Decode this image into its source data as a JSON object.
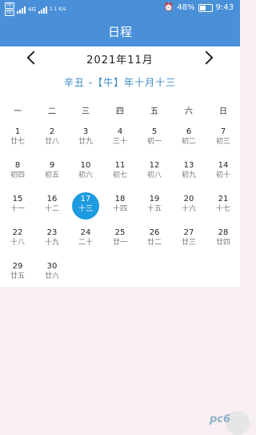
{
  "status_bar": {
    "sim1": "HD",
    "sim2": "HD",
    "network": "4G",
    "speed": "1.1 K/s",
    "battery": "48%",
    "time": "9:43"
  },
  "header": {
    "title": "日程"
  },
  "calendar": {
    "month_label": "2021年11月",
    "lunar_label": "辛丑 -【牛】年十月十三",
    "weekdays": [
      "一",
      "二",
      "三",
      "四",
      "五",
      "六",
      "日"
    ],
    "days": [
      {
        "day": "1",
        "lunar": "廿七"
      },
      {
        "day": "2",
        "lunar": "廿八"
      },
      {
        "day": "3",
        "lunar": "廿九"
      },
      {
        "day": "4",
        "lunar": "三十"
      },
      {
        "day": "5",
        "lunar": "初一"
      },
      {
        "day": "6",
        "lunar": "初二"
      },
      {
        "day": "7",
        "lunar": "初三"
      },
      {
        "day": "8",
        "lunar": "初四"
      },
      {
        "day": "9",
        "lunar": "初五"
      },
      {
        "day": "10",
        "lunar": "初六"
      },
      {
        "day": "11",
        "lunar": "初七"
      },
      {
        "day": "12",
        "lunar": "初八"
      },
      {
        "day": "13",
        "lunar": "初九"
      },
      {
        "day": "14",
        "lunar": "初十"
      },
      {
        "day": "15",
        "lunar": "十一"
      },
      {
        "day": "16",
        "lunar": "十二"
      },
      {
        "day": "17",
        "lunar": "十三"
      },
      {
        "day": "18",
        "lunar": "十四"
      },
      {
        "day": "19",
        "lunar": "十五"
      },
      {
        "day": "20",
        "lunar": "十六"
      },
      {
        "day": "21",
        "lunar": "十七"
      },
      {
        "day": "22",
        "lunar": "十八"
      },
      {
        "day": "23",
        "lunar": "十九"
      },
      {
        "day": "24",
        "lunar": "二十"
      },
      {
        "day": "25",
        "lunar": "廿一"
      },
      {
        "day": "26",
        "lunar": "廿二"
      },
      {
        "day": "27",
        "lunar": "廿三"
      },
      {
        "day": "28",
        "lunar": "廿四"
      },
      {
        "day": "29",
        "lunar": "廿五"
      },
      {
        "day": "30",
        "lunar": "廿六"
      }
    ],
    "selected_day": "17",
    "first_weekday_index": 0
  },
  "colors": {
    "header_bg": "#4a90d9",
    "accent": "#1e9be0",
    "lunar_label": "#3b8ac7",
    "background": "#f7eff3"
  },
  "watermark": {
    "text": "pc6"
  },
  "icons": {
    "prev": "chevron-left-icon",
    "next": "chevron-right-icon",
    "alarm": "alarm-icon",
    "battery": "battery-icon"
  }
}
